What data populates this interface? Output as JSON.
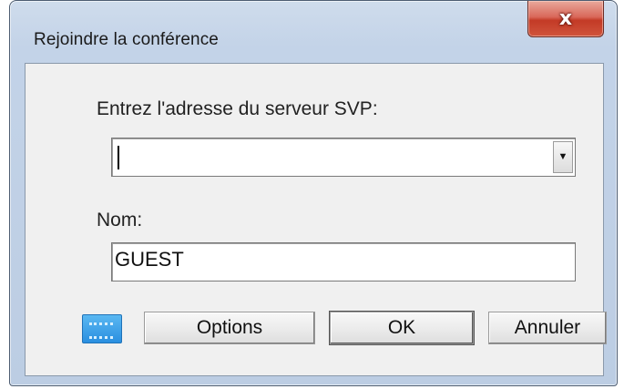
{
  "window": {
    "title": "Rejoindre la conférence",
    "close_glyph": "x"
  },
  "form": {
    "server_label": "Entrez l'adresse du serveur SVP:",
    "server_value": "",
    "name_label": "Nom:",
    "name_value": "GUEST"
  },
  "buttons": {
    "options": "Options",
    "ok": "OK",
    "cancel": "Annuler"
  },
  "icons": {
    "keyboard": "keyboard-icon",
    "dropdown": "chevron-down-icon"
  }
}
